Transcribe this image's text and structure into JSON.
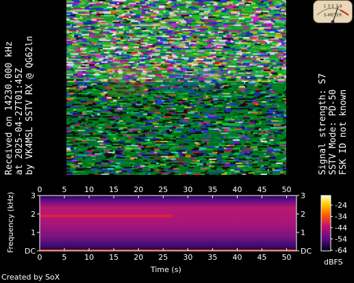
{
  "left_caption": {
    "line1": "Received on  14230.000 kHz",
    "line2": "at 2025-04-27T01:45Z",
    "line3": "by VK4MSL SSTV RX @ QG62ln"
  },
  "right_caption": {
    "line1": "Signal strength: S7",
    "line2": "SSTV Mode: PD-50",
    "line3": "FSK ID not known"
  },
  "credit": "Created by SoX",
  "meter": {
    "scale": "1 3 5 7 9",
    "label": "S-METER"
  },
  "spectrogram": {
    "ylabel": "Frequency (kHz)",
    "xlabel": "Time (s)",
    "x_ticks": [
      "0",
      "5",
      "10",
      "15",
      "20",
      "25",
      "30",
      "35",
      "40",
      "45",
      "50"
    ],
    "y_ticks": [
      "DC",
      "1",
      "2",
      "3"
    ],
    "colorbar_ticks": [
      "-24",
      "-34",
      "-44",
      "-54",
      "-64"
    ],
    "colorbar_unit": "dBFS",
    "x_range": [
      0,
      52
    ],
    "y_range": [
      0,
      3
    ],
    "tone_khz": 1.9,
    "tone_end_s": 27,
    "colors": {
      "background": "#000000",
      "plot": "#5a0d86",
      "band": "#c2186a",
      "tone": "#ff3000",
      "axis": "#ffffff"
    }
  }
}
